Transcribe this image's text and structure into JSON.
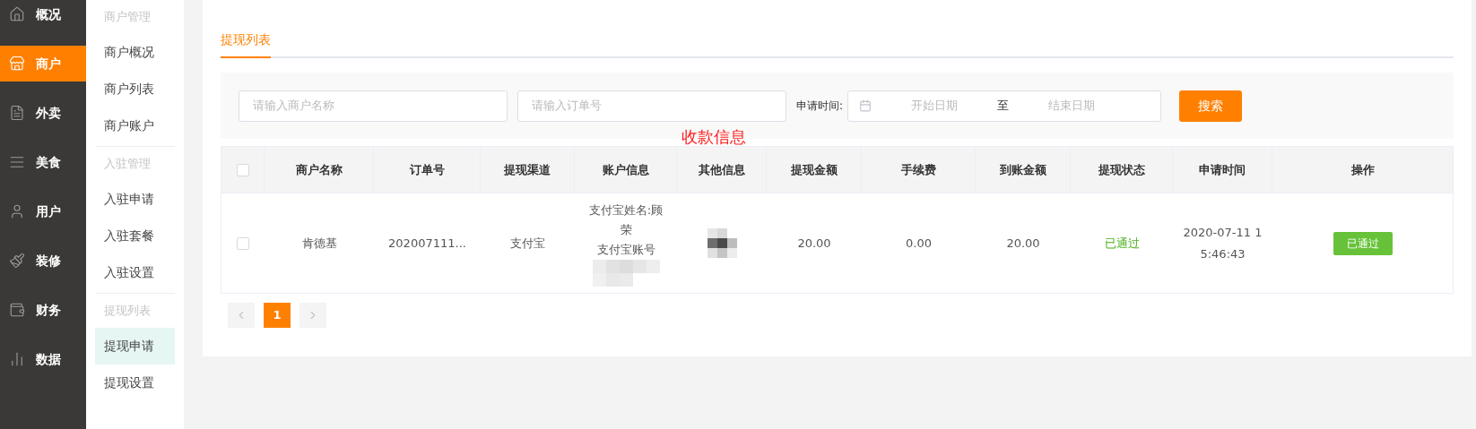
{
  "nav": [
    {
      "label": "概况",
      "selected": false
    },
    {
      "label": "商户",
      "selected": true
    },
    {
      "label": "外卖",
      "selected": false
    },
    {
      "label": "美食",
      "selected": false
    },
    {
      "label": "用户",
      "selected": false
    },
    {
      "label": "装修",
      "selected": false
    },
    {
      "label": "财务",
      "selected": false
    },
    {
      "label": "数据",
      "selected": false
    }
  ],
  "subnav": [
    {
      "title": "商户管理",
      "items": [
        {
          "label": "商户概况",
          "selected": false
        },
        {
          "label": "商户列表",
          "selected": false
        },
        {
          "label": "商户账户",
          "selected": false
        }
      ]
    },
    {
      "title": "入驻管理",
      "items": [
        {
          "label": "入驻申请",
          "selected": false
        },
        {
          "label": "入驻套餐",
          "selected": false
        },
        {
          "label": "入驻设置",
          "selected": false
        }
      ]
    },
    {
      "title": "提现列表",
      "items": [
        {
          "label": "提现申请",
          "selected": true
        },
        {
          "label": "提现设置",
          "selected": false
        }
      ]
    }
  ],
  "tabs": [
    {
      "label": "提现列表",
      "selected": true
    }
  ],
  "filters": {
    "merchant_field": {
      "placeholder": "请输入商户名称"
    },
    "order_field": {
      "placeholder": "请输入订单号"
    },
    "date_range": {
      "label": "申请时间:",
      "start_placeholder": "开始日期",
      "separator": "至",
      "end_placeholder": "结束日期"
    },
    "search_button": "搜索"
  },
  "annotation": "收款信息",
  "table": {
    "select_all": {
      "checked": false
    },
    "columns": [
      "商户名称",
      "订单号",
      "提现渠道",
      "账户信息",
      "其他信息",
      "提现金额",
      "手续费",
      "到账金额",
      "提现状态",
      "申请时间",
      "操作"
    ],
    "rows": [
      {
        "checked": false,
        "merchant": "肯德基",
        "order_no": "202007111...",
        "channel": "支付宝",
        "account_name": "支付宝姓名:顾荣",
        "account_no_label": "支付宝账号",
        "amount": "20.00",
        "fee": "0.00",
        "received": "20.00",
        "status": "已通过",
        "time": "2020-07-11 15:46:43",
        "action": "已通过"
      }
    ]
  },
  "pagination": {
    "pages": [
      {
        "label": "1",
        "selected": true
      }
    ]
  }
}
